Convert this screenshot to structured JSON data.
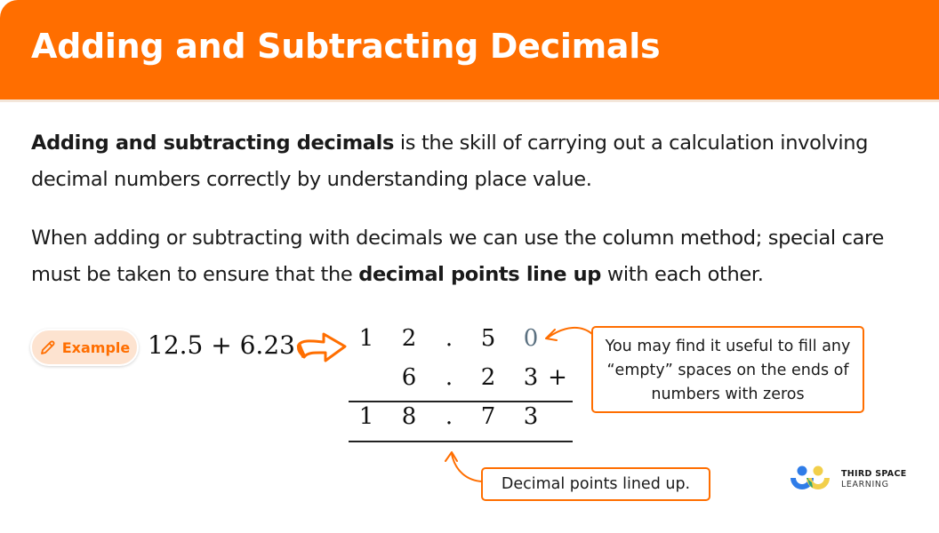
{
  "header": {
    "title": "Adding and Subtracting Decimals",
    "color": "#ff6e00"
  },
  "intro": {
    "bold_term": "Adding and subtracting decimals",
    "definition_rest": " is the skill of carrying out a calculation involving decimal numbers correctly by understanding place value."
  },
  "method": {
    "text_before": "When adding or subtracting with decimals we can use the column method; special care must be taken to ensure that the ",
    "bold_phrase": "decimal points line up",
    "text_after": " with each other."
  },
  "example": {
    "badge_label": "Example",
    "badge_icon": "pencil-icon",
    "expression": "12.5 + 6.23",
    "arrow_icon": "curved-right-arrow-icon",
    "column_rows": [
      [
        "1",
        "2",
        ".",
        "5",
        "0",
        ""
      ],
      [
        "",
        "6",
        ".",
        "2",
        "3",
        "+"
      ],
      [
        "1",
        "8",
        ".",
        "7",
        "3",
        ""
      ]
    ],
    "placeholder_zero_color": "#5a7080"
  },
  "callouts": {
    "zeros_note": "You may find it useful to fill any “empty” spaces on the ends of numbers with zeros",
    "points_note": "Decimal points lined up."
  },
  "logo": {
    "line1": "THIRD SPACE",
    "line2": "LEARNING",
    "colors": {
      "blue": "#2f7ce8",
      "yellow": "#f2cf4a",
      "green": "#2aa57a"
    }
  }
}
